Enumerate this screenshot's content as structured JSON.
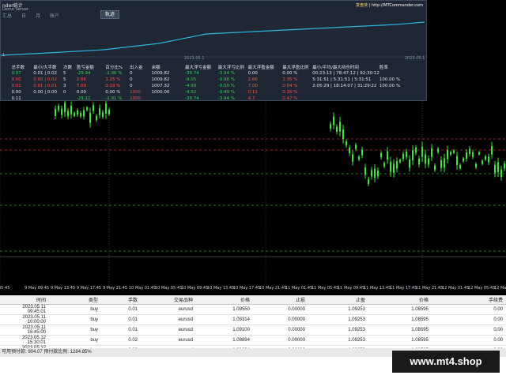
{
  "overlay": {
    "title": "nder统计",
    "subtitle": "Demo Server",
    "brand_a": "复盘侠",
    "brand_b": " | http://MTCommander.com",
    "tabs": [
      "汇总",
      "日",
      "月",
      "账户"
    ],
    "button": "轨迹",
    "date_left": "2023.05.1",
    "date_right": "2023.05.1",
    "axis_label": "1",
    "headers": [
      "总手数",
      "最小/大手数",
      "次数",
      "盈亏金额",
      "百分比%",
      "出入金",
      "余额",
      "最大浮亏金额",
      "最大浮亏比例",
      "最大浮盈金额",
      "最大浮盈比例",
      "最小/平均/最大持仓时间",
      "胜率"
    ],
    "rows": [
      {
        "label": "",
        "cells": [
          "0.07",
          "0.01 | 0.02",
          "5",
          "-29.94",
          "-2.96 %",
          "0",
          "1009.82",
          "-39.74",
          "-3.94 %",
          "0.00",
          "0.00 %",
          "00:23:13 | 78:47:12 | 92:30:12",
          ""
        ]
      },
      {
        "label": "",
        "cells": [
          "0.00",
          "0.00 | 0.02",
          "5",
          "2.66",
          "3.25 %",
          "0",
          "1009.82",
          "-9.05",
          "-0.98 %",
          "2.66",
          "2.35 %",
          "5:31:51 | 5:31:51 | 5:31:51",
          "100.00 %"
        ]
      },
      {
        "label": "",
        "cells": [
          "0.02",
          "0.01 | 0.01",
          "3",
          "7.00",
          "0.19 %",
          "0",
          "1007.32",
          "-4.90",
          "-0.50 %",
          "7.00",
          "0.04 %",
          "2:05:29 | 18:14:07 | 31:29:22",
          "100.00 %"
        ]
      },
      {
        "label": "",
        "cells": [
          "0.00",
          "0.00 | 0.00",
          "0",
          "0.00",
          "0.00 %",
          "1000",
          "1000.00",
          "-4.92",
          "-0.49 %",
          "0.11",
          "0.16 %",
          "",
          ""
        ]
      },
      {
        "label": "",
        "cells": [
          "0.11",
          "",
          "",
          "-29.12",
          "-2.91 %",
          "1000",
          "",
          "-39.74",
          "-3.94 %",
          "4.7",
          "0.47 %",
          "",
          ""
        ]
      }
    ]
  },
  "xaxis": [
    "05:45",
    "9 May 09:45",
    "9 May 13:45",
    "9 May 17:45",
    "9 May 21:45",
    "10 May 01:45",
    "10 May 05:45",
    "10 May 09:45",
    "10 May 13:45",
    "10 May 17:45",
    "10 May 21:45",
    "11 May 01:45",
    "11 May 05:45",
    "11 May 09:45",
    "11 May 13:45",
    "11 May 17:45",
    "11 May 21:45",
    "12 May 01:45",
    "12 May 05:45",
    "12 May 09:45"
  ],
  "trades": {
    "headers": [
      "时间",
      "类型",
      "手数",
      "交易品种",
      "价格",
      "止损",
      "止盈",
      "价格",
      "手续费"
    ],
    "rows": [
      [
        "2023.05.11 09:45:01",
        "buy",
        "0.01",
        "eurusd",
        "1.09550",
        "0.00000",
        "1.09253",
        "1.08595",
        "0.00"
      ],
      [
        "2023.05.11 10:00:00",
        "buy",
        "0.01",
        "eurusd",
        "1.09314",
        "0.00000",
        "1.09253",
        "1.08595",
        "0.00"
      ],
      [
        "2023.05.11 16:45:00",
        "buy",
        "0.01",
        "eurusd",
        "1.09100",
        "0.00000",
        "1.09253",
        "1.08595",
        "0.00"
      ],
      [
        "2023.05.12 15:30:01",
        "buy",
        "0.02",
        "eurusd",
        "1.08894",
        "0.00000",
        "1.09253",
        "1.08595",
        "0.00"
      ],
      [
        "2023.05.12 18:00:00",
        "buy",
        "0.02",
        "eurusd",
        "1.08634",
        "0.00000",
        "1.09253",
        "1.08595",
        "0.00"
      ]
    ]
  },
  "status": "可用预付款: 904.07   预付款比例: 1284.85%",
  "watermark": "www.mt4.shop",
  "colors": {
    "candle": "#39e639",
    "equity": "#2bb5e0",
    "neg": "#ff4d4d",
    "pos": "#34d058"
  }
}
